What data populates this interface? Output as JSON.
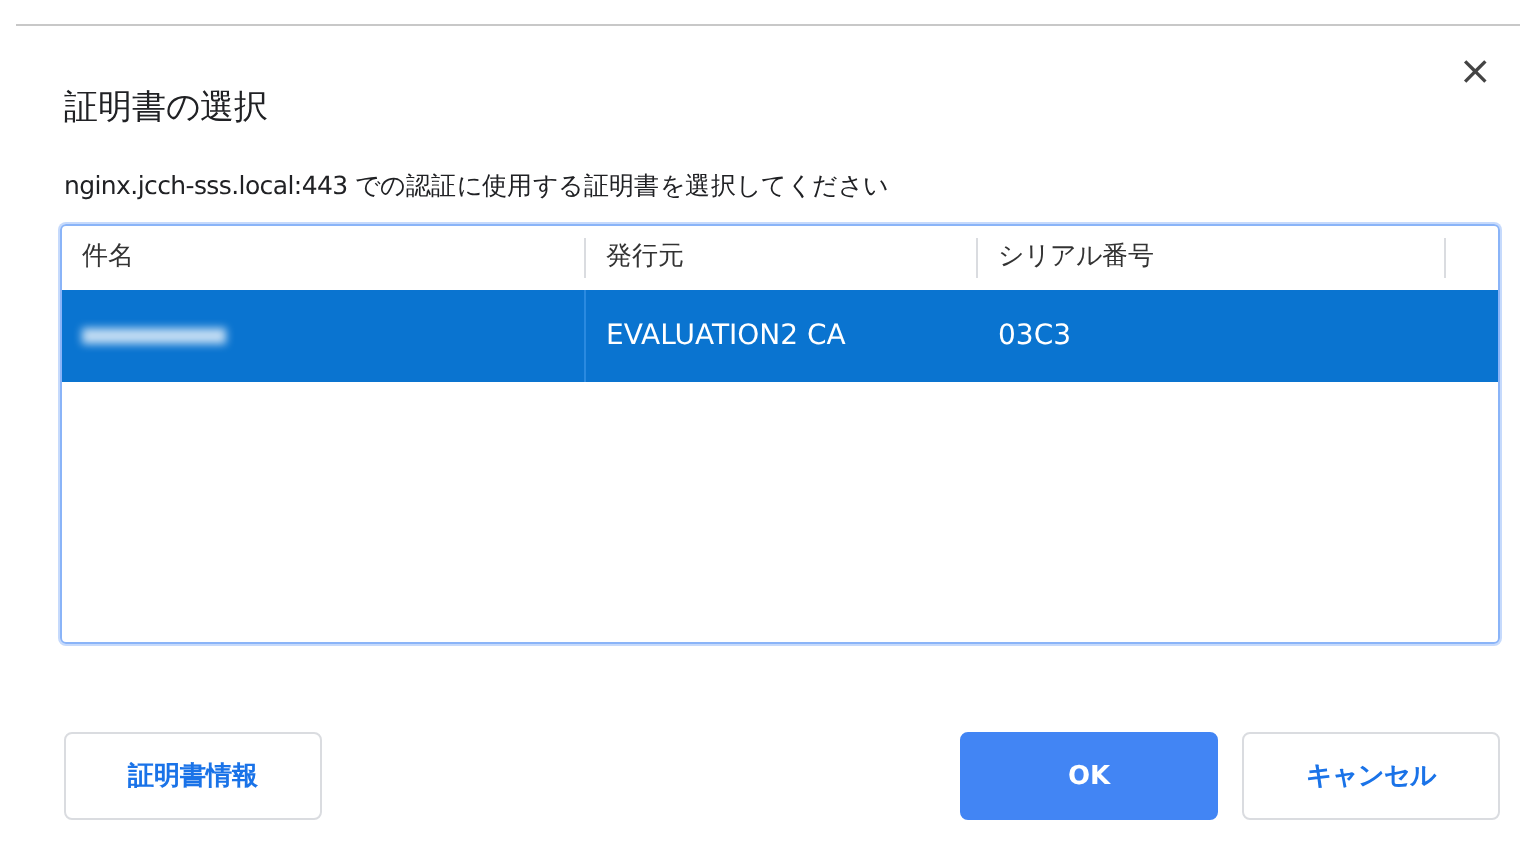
{
  "dialog": {
    "title": "証明書の選択",
    "close": "×",
    "message": "nginx.jcch-sss.local:443 での認証に使用する証明書を選択してください"
  },
  "table": {
    "columns": [
      "件名",
      "発行元",
      "シリアル番号"
    ],
    "rows": [
      {
        "subject_redacted": true,
        "issuer": "EVALUATION2 CA",
        "serial": "03C3",
        "selected": true
      }
    ]
  },
  "buttons": [
    {
      "label": "証明書情報",
      "kind": "secondary"
    },
    {
      "label": "OK",
      "kind": "primary"
    },
    {
      "label": "キャンセル",
      "kind": "secondary"
    }
  ]
}
